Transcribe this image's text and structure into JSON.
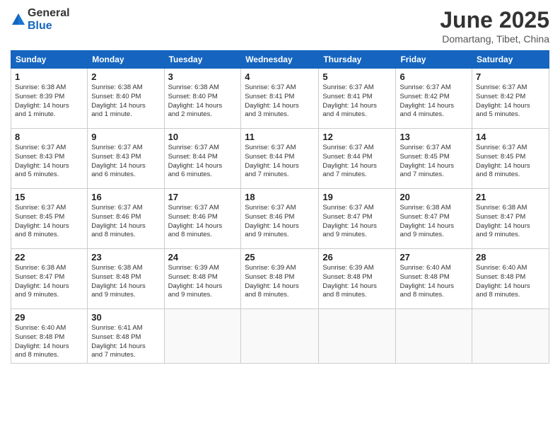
{
  "logo": {
    "general": "General",
    "blue": "Blue"
  },
  "title": "June 2025",
  "location": "Domartang, Tibet, China",
  "headers": [
    "Sunday",
    "Monday",
    "Tuesday",
    "Wednesday",
    "Thursday",
    "Friday",
    "Saturday"
  ],
  "weeks": [
    [
      {
        "day": "1",
        "info": "Sunrise: 6:38 AM\nSunset: 8:39 PM\nDaylight: 14 hours\nand 1 minute."
      },
      {
        "day": "2",
        "info": "Sunrise: 6:38 AM\nSunset: 8:40 PM\nDaylight: 14 hours\nand 1 minute."
      },
      {
        "day": "3",
        "info": "Sunrise: 6:38 AM\nSunset: 8:40 PM\nDaylight: 14 hours\nand 2 minutes."
      },
      {
        "day": "4",
        "info": "Sunrise: 6:37 AM\nSunset: 8:41 PM\nDaylight: 14 hours\nand 3 minutes."
      },
      {
        "day": "5",
        "info": "Sunrise: 6:37 AM\nSunset: 8:41 PM\nDaylight: 14 hours\nand 4 minutes."
      },
      {
        "day": "6",
        "info": "Sunrise: 6:37 AM\nSunset: 8:42 PM\nDaylight: 14 hours\nand 4 minutes."
      },
      {
        "day": "7",
        "info": "Sunrise: 6:37 AM\nSunset: 8:42 PM\nDaylight: 14 hours\nand 5 minutes."
      }
    ],
    [
      {
        "day": "8",
        "info": "Sunrise: 6:37 AM\nSunset: 8:43 PM\nDaylight: 14 hours\nand 5 minutes."
      },
      {
        "day": "9",
        "info": "Sunrise: 6:37 AM\nSunset: 8:43 PM\nDaylight: 14 hours\nand 6 minutes."
      },
      {
        "day": "10",
        "info": "Sunrise: 6:37 AM\nSunset: 8:44 PM\nDaylight: 14 hours\nand 6 minutes."
      },
      {
        "day": "11",
        "info": "Sunrise: 6:37 AM\nSunset: 8:44 PM\nDaylight: 14 hours\nand 7 minutes."
      },
      {
        "day": "12",
        "info": "Sunrise: 6:37 AM\nSunset: 8:44 PM\nDaylight: 14 hours\nand 7 minutes."
      },
      {
        "day": "13",
        "info": "Sunrise: 6:37 AM\nSunset: 8:45 PM\nDaylight: 14 hours\nand 7 minutes."
      },
      {
        "day": "14",
        "info": "Sunrise: 6:37 AM\nSunset: 8:45 PM\nDaylight: 14 hours\nand 8 minutes."
      }
    ],
    [
      {
        "day": "15",
        "info": "Sunrise: 6:37 AM\nSunset: 8:45 PM\nDaylight: 14 hours\nand 8 minutes."
      },
      {
        "day": "16",
        "info": "Sunrise: 6:37 AM\nSunset: 8:46 PM\nDaylight: 14 hours\nand 8 minutes."
      },
      {
        "day": "17",
        "info": "Sunrise: 6:37 AM\nSunset: 8:46 PM\nDaylight: 14 hours\nand 8 minutes."
      },
      {
        "day": "18",
        "info": "Sunrise: 6:37 AM\nSunset: 8:46 PM\nDaylight: 14 hours\nand 9 minutes."
      },
      {
        "day": "19",
        "info": "Sunrise: 6:37 AM\nSunset: 8:47 PM\nDaylight: 14 hours\nand 9 minutes."
      },
      {
        "day": "20",
        "info": "Sunrise: 6:38 AM\nSunset: 8:47 PM\nDaylight: 14 hours\nand 9 minutes."
      },
      {
        "day": "21",
        "info": "Sunrise: 6:38 AM\nSunset: 8:47 PM\nDaylight: 14 hours\nand 9 minutes."
      }
    ],
    [
      {
        "day": "22",
        "info": "Sunrise: 6:38 AM\nSunset: 8:47 PM\nDaylight: 14 hours\nand 9 minutes."
      },
      {
        "day": "23",
        "info": "Sunrise: 6:38 AM\nSunset: 8:48 PM\nDaylight: 14 hours\nand 9 minutes."
      },
      {
        "day": "24",
        "info": "Sunrise: 6:39 AM\nSunset: 8:48 PM\nDaylight: 14 hours\nand 9 minutes."
      },
      {
        "day": "25",
        "info": "Sunrise: 6:39 AM\nSunset: 8:48 PM\nDaylight: 14 hours\nand 8 minutes."
      },
      {
        "day": "26",
        "info": "Sunrise: 6:39 AM\nSunset: 8:48 PM\nDaylight: 14 hours\nand 8 minutes."
      },
      {
        "day": "27",
        "info": "Sunrise: 6:40 AM\nSunset: 8:48 PM\nDaylight: 14 hours\nand 8 minutes."
      },
      {
        "day": "28",
        "info": "Sunrise: 6:40 AM\nSunset: 8:48 PM\nDaylight: 14 hours\nand 8 minutes."
      }
    ],
    [
      {
        "day": "29",
        "info": "Sunrise: 6:40 AM\nSunset: 8:48 PM\nDaylight: 14 hours\nand 8 minutes."
      },
      {
        "day": "30",
        "info": "Sunrise: 6:41 AM\nSunset: 8:48 PM\nDaylight: 14 hours\nand 7 minutes."
      },
      {
        "day": "",
        "info": ""
      },
      {
        "day": "",
        "info": ""
      },
      {
        "day": "",
        "info": ""
      },
      {
        "day": "",
        "info": ""
      },
      {
        "day": "",
        "info": ""
      }
    ]
  ]
}
